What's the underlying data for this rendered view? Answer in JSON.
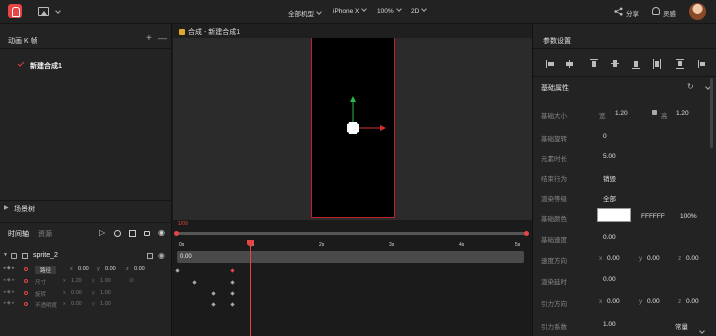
{
  "topbar": {
    "device_filter": "全部机型",
    "device": "iPhone X",
    "zoom": "100%",
    "mode": "2D",
    "share_label": "分享",
    "inspiration_label": "灵感"
  },
  "left_panel": {
    "anim_header": "动画 K 帧",
    "composition_item": "新建合成1",
    "scene_tree_label": "场景树",
    "timeline_tab": "时间轴",
    "resources_tab": "资源",
    "sprite_name": "sprite_2",
    "tracks": [
      {
        "label": "路径",
        "x_label": "x",
        "x_val": "0.00",
        "y_label": "y",
        "y_val": "0.00",
        "z_label": "z",
        "z_val": "0.00"
      },
      {
        "label": "尺寸",
        "x_label": "x",
        "x_val": "1.20",
        "y_label": "y",
        "y_val": "1.00"
      },
      {
        "label": "旋转",
        "x_label": "x",
        "x_val": "0.00",
        "y_label": "y",
        "y_val": "1.00"
      },
      {
        "label": "不透明度",
        "x_label": "x",
        "x_val": "0.00",
        "y_label": "y",
        "y_val": "1.00"
      }
    ]
  },
  "center": {
    "tab_title": "合成 - 新建合成1",
    "current_time": "1/09",
    "ticks": [
      "0s",
      "1s",
      "2s",
      "3s",
      "4s",
      "5s"
    ],
    "track_value": "0.00"
  },
  "right_panel": {
    "header": "参数设置",
    "section_title": "基础属性",
    "props": [
      {
        "label": "基础大小",
        "sub1": "宽",
        "val1": "1.20",
        "sub2": "高",
        "val2": "1.20"
      },
      {
        "label": "基础旋转",
        "val1": "0"
      },
      {
        "label": "元素时长",
        "val1": "5.00"
      },
      {
        "label": "结束行为",
        "val1": "销毁"
      },
      {
        "label": "渲染等级",
        "val1": "全部"
      },
      {
        "label": "基础颜色",
        "val1": "FFFFFF",
        "val2": "100%"
      },
      {
        "label": "基础速度",
        "val1": "0.00"
      },
      {
        "label": "速度方向",
        "x": "x",
        "xv": "0.00",
        "y": "y",
        "yv": "0.00",
        "z": "z",
        "zv": "0.00"
      },
      {
        "label": "渲染延时",
        "val1": "0.00"
      },
      {
        "label": "引力方向",
        "x": "x",
        "xv": "0.00",
        "y": "y",
        "yv": "0.00",
        "z": "z",
        "zv": "0.00"
      },
      {
        "label": "引力系数",
        "val1": "1.00",
        "val2": "常量"
      }
    ]
  },
  "colors": {
    "accent": "#e64545",
    "swatch": "#FFFFFF"
  }
}
